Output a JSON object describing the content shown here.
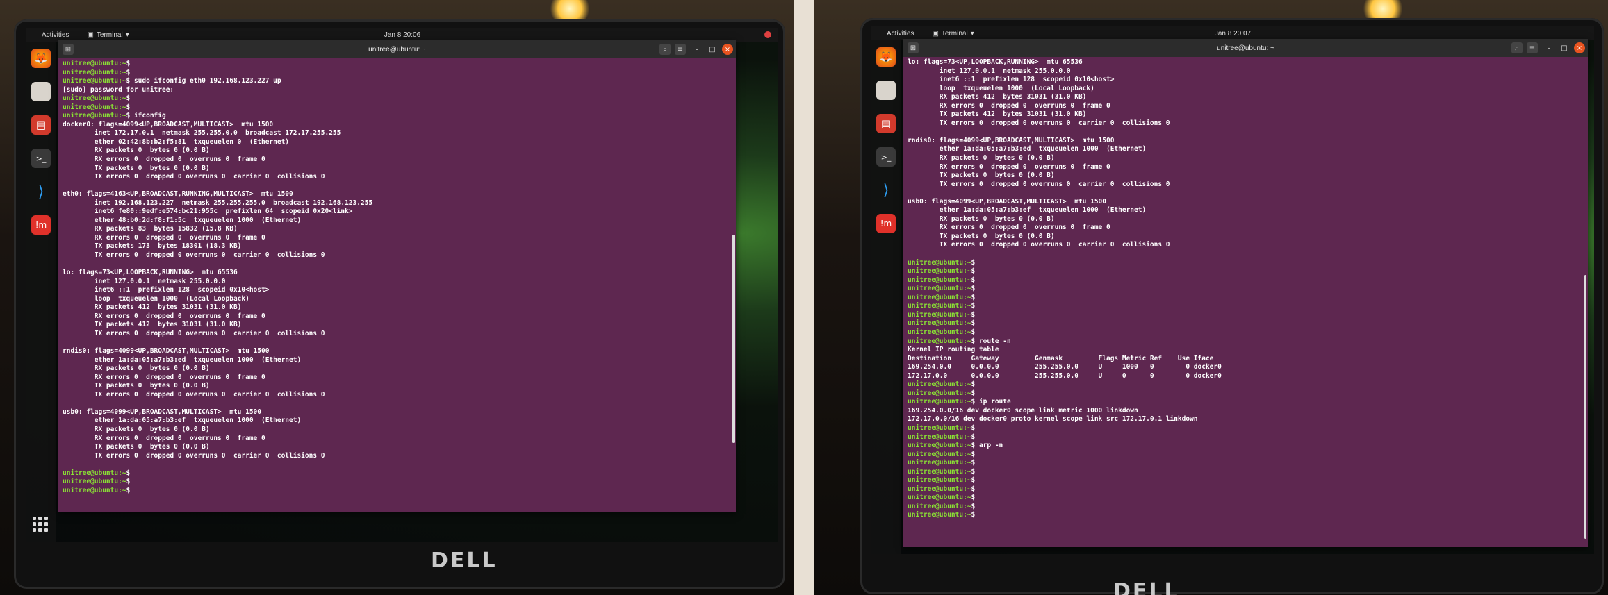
{
  "left": {
    "topbar": {
      "activities": "Activities",
      "app": "Terminal",
      "clock": "Jan 8  20:06"
    },
    "window_title": "unitree@ubuntu: ~",
    "lines": [
      {
        "p": "unitree@ubuntu:~",
        "t": "$"
      },
      {
        "p": "unitree@ubuntu:~",
        "t": "$"
      },
      {
        "p": "unitree@ubuntu:~",
        "t": "$ sudo ifconfig eth0 192.168.123.227 up"
      },
      {
        "p": "",
        "t": "[sudo] password for unitree:"
      },
      {
        "p": "unitree@ubuntu:~",
        "t": "$"
      },
      {
        "p": "unitree@ubuntu:~",
        "t": "$"
      },
      {
        "p": "unitree@ubuntu:~",
        "t": "$ ifconfig"
      },
      {
        "p": "",
        "t": "docker0: flags=4099<UP,BROADCAST,MULTICAST>  mtu 1500"
      },
      {
        "p": "",
        "t": "        inet 172.17.0.1  netmask 255.255.0.0  broadcast 172.17.255.255"
      },
      {
        "p": "",
        "t": "        ether 02:42:8b:b2:f5:81  txqueuelen 0  (Ethernet)"
      },
      {
        "p": "",
        "t": "        RX packets 0  bytes 0 (0.0 B)"
      },
      {
        "p": "",
        "t": "        RX errors 0  dropped 0  overruns 0  frame 0"
      },
      {
        "p": "",
        "t": "        TX packets 0  bytes 0 (0.0 B)"
      },
      {
        "p": "",
        "t": "        TX errors 0  dropped 0 overruns 0  carrier 0  collisions 0"
      },
      {
        "p": "",
        "t": ""
      },
      {
        "p": "",
        "t": "eth0: flags=4163<UP,BROADCAST,RUNNING,MULTICAST>  mtu 1500"
      },
      {
        "p": "",
        "t": "        inet 192.168.123.227  netmask 255.255.255.0  broadcast 192.168.123.255"
      },
      {
        "p": "",
        "t": "        inet6 fe80::9edf:e574:bc21:955c  prefixlen 64  scopeid 0x20<link>"
      },
      {
        "p": "",
        "t": "        ether 48:b0:2d:f8:f1:5c  txqueuelen 1000  (Ethernet)"
      },
      {
        "p": "",
        "t": "        RX packets 83  bytes 15832 (15.8 KB)"
      },
      {
        "p": "",
        "t": "        RX errors 0  dropped 0  overruns 0  frame 0"
      },
      {
        "p": "",
        "t": "        TX packets 173  bytes 18301 (18.3 KB)"
      },
      {
        "p": "",
        "t": "        TX errors 0  dropped 0 overruns 0  carrier 0  collisions 0"
      },
      {
        "p": "",
        "t": ""
      },
      {
        "p": "",
        "t": "lo: flags=73<UP,LOOPBACK,RUNNING>  mtu 65536"
      },
      {
        "p": "",
        "t": "        inet 127.0.0.1  netmask 255.0.0.0"
      },
      {
        "p": "",
        "t": "        inet6 ::1  prefixlen 128  scopeid 0x10<host>"
      },
      {
        "p": "",
        "t": "        loop  txqueuelen 1000  (Local Loopback)"
      },
      {
        "p": "",
        "t": "        RX packets 412  bytes 31031 (31.0 KB)"
      },
      {
        "p": "",
        "t": "        RX errors 0  dropped 0  overruns 0  frame 0"
      },
      {
        "p": "",
        "t": "        TX packets 412  bytes 31031 (31.0 KB)"
      },
      {
        "p": "",
        "t": "        TX errors 0  dropped 0 overruns 0  carrier 0  collisions 0"
      },
      {
        "p": "",
        "t": ""
      },
      {
        "p": "",
        "t": "rndis0: flags=4099<UP,BROADCAST,MULTICAST>  mtu 1500"
      },
      {
        "p": "",
        "t": "        ether 1a:da:05:a7:b3:ed  txqueuelen 1000  (Ethernet)"
      },
      {
        "p": "",
        "t": "        RX packets 0  bytes 0 (0.0 B)"
      },
      {
        "p": "",
        "t": "        RX errors 0  dropped 0  overruns 0  frame 0"
      },
      {
        "p": "",
        "t": "        TX packets 0  bytes 0 (0.0 B)"
      },
      {
        "p": "",
        "t": "        TX errors 0  dropped 0 overruns 0  carrier 0  collisions 0"
      },
      {
        "p": "",
        "t": ""
      },
      {
        "p": "",
        "t": "usb0: flags=4099<UP,BROADCAST,MULTICAST>  mtu 1500"
      },
      {
        "p": "",
        "t": "        ether 1a:da:05:a7:b3:ef  txqueuelen 1000  (Ethernet)"
      },
      {
        "p": "",
        "t": "        RX packets 0  bytes 0 (0.0 B)"
      },
      {
        "p": "",
        "t": "        RX errors 0  dropped 0  overruns 0  frame 0"
      },
      {
        "p": "",
        "t": "        TX packets 0  bytes 0 (0.0 B)"
      },
      {
        "p": "",
        "t": "        TX errors 0  dropped 0 overruns 0  carrier 0  collisions 0"
      },
      {
        "p": "",
        "t": ""
      },
      {
        "p": "unitree@ubuntu:~",
        "t": "$"
      },
      {
        "p": "unitree@ubuntu:~",
        "t": "$"
      },
      {
        "p": "unitree@ubuntu:~",
        "t": "$"
      }
    ]
  },
  "right": {
    "topbar": {
      "activities": "Activities",
      "app": "Terminal",
      "clock": "Jan 8  20:07"
    },
    "window_title": "unitree@ubuntu: ~",
    "lines": [
      {
        "p": "",
        "t": "lo: flags=73<UP,LOOPBACK,RUNNING>  mtu 65536"
      },
      {
        "p": "",
        "t": "        inet 127.0.0.1  netmask 255.0.0.0"
      },
      {
        "p": "",
        "t": "        inet6 ::1  prefixlen 128  scopeid 0x10<host>"
      },
      {
        "p": "",
        "t": "        loop  txqueuelen 1000  (Local Loopback)"
      },
      {
        "p": "",
        "t": "        RX packets 412  bytes 31031 (31.0 KB)"
      },
      {
        "p": "",
        "t": "        RX errors 0  dropped 0  overruns 0  frame 0"
      },
      {
        "p": "",
        "t": "        TX packets 412  bytes 31031 (31.0 KB)"
      },
      {
        "p": "",
        "t": "        TX errors 0  dropped 0 overruns 0  carrier 0  collisions 0"
      },
      {
        "p": "",
        "t": ""
      },
      {
        "p": "",
        "t": "rndis0: flags=4099<UP,BROADCAST,MULTICAST>  mtu 1500"
      },
      {
        "p": "",
        "t": "        ether 1a:da:05:a7:b3:ed  txqueuelen 1000  (Ethernet)"
      },
      {
        "p": "",
        "t": "        RX packets 0  bytes 0 (0.0 B)"
      },
      {
        "p": "",
        "t": "        RX errors 0  dropped 0  overruns 0  frame 0"
      },
      {
        "p": "",
        "t": "        TX packets 0  bytes 0 (0.0 B)"
      },
      {
        "p": "",
        "t": "        TX errors 0  dropped 0 overruns 0  carrier 0  collisions 0"
      },
      {
        "p": "",
        "t": ""
      },
      {
        "p": "",
        "t": "usb0: flags=4099<UP,BROADCAST,MULTICAST>  mtu 1500"
      },
      {
        "p": "",
        "t": "        ether 1a:da:05:a7:b3:ef  txqueuelen 1000  (Ethernet)"
      },
      {
        "p": "",
        "t": "        RX packets 0  bytes 0 (0.0 B)"
      },
      {
        "p": "",
        "t": "        RX errors 0  dropped 0  overruns 0  frame 0"
      },
      {
        "p": "",
        "t": "        TX packets 0  bytes 0 (0.0 B)"
      },
      {
        "p": "",
        "t": "        TX errors 0  dropped 0 overruns 0  carrier 0  collisions 0"
      },
      {
        "p": "",
        "t": ""
      },
      {
        "p": "unitree@ubuntu:~",
        "t": "$"
      },
      {
        "p": "unitree@ubuntu:~",
        "t": "$"
      },
      {
        "p": "unitree@ubuntu:~",
        "t": "$"
      },
      {
        "p": "unitree@ubuntu:~",
        "t": "$"
      },
      {
        "p": "unitree@ubuntu:~",
        "t": "$"
      },
      {
        "p": "unitree@ubuntu:~",
        "t": "$"
      },
      {
        "p": "unitree@ubuntu:~",
        "t": "$"
      },
      {
        "p": "unitree@ubuntu:~",
        "t": "$"
      },
      {
        "p": "unitree@ubuntu:~",
        "t": "$"
      },
      {
        "p": "unitree@ubuntu:~",
        "t": "$ route -n"
      },
      {
        "p": "",
        "t": "Kernel IP routing table"
      },
      {
        "p": "",
        "t": "Destination     Gateway         Genmask         Flags Metric Ref    Use Iface"
      },
      {
        "p": "",
        "t": "169.254.0.0     0.0.0.0         255.255.0.0     U     1000   0        0 docker0"
      },
      {
        "p": "",
        "t": "172.17.0.0      0.0.0.0         255.255.0.0     U     0      0        0 docker0"
      },
      {
        "p": "unitree@ubuntu:~",
        "t": "$"
      },
      {
        "p": "unitree@ubuntu:~",
        "t": "$"
      },
      {
        "p": "unitree@ubuntu:~",
        "t": "$ ip route"
      },
      {
        "p": "",
        "t": "169.254.0.0/16 dev docker0 scope link metric 1000 linkdown"
      },
      {
        "p": "",
        "t": "172.17.0.0/16 dev docker0 proto kernel scope link src 172.17.0.1 linkdown"
      },
      {
        "p": "unitree@ubuntu:~",
        "t": "$"
      },
      {
        "p": "unitree@ubuntu:~",
        "t": "$"
      },
      {
        "p": "unitree@ubuntu:~",
        "t": "$ arp -n"
      },
      {
        "p": "unitree@ubuntu:~",
        "t": "$"
      },
      {
        "p": "unitree@ubuntu:~",
        "t": "$"
      },
      {
        "p": "unitree@ubuntu:~",
        "t": "$"
      },
      {
        "p": "unitree@ubuntu:~",
        "t": "$"
      },
      {
        "p": "unitree@ubuntu:~",
        "t": "$"
      },
      {
        "p": "unitree@ubuntu:~",
        "t": "$"
      },
      {
        "p": "unitree@ubuntu:~",
        "t": "$"
      },
      {
        "p": "unitree@ubuntu:~",
        "t": "$"
      }
    ]
  },
  "dock_icons": [
    "firefox-icon",
    "files-icon",
    "software-icon",
    "terminal-icon",
    "vscode-icon",
    "app-red-icon"
  ],
  "brand": "DELL",
  "colors": {
    "terminal_bg": "#5e2750",
    "prompt": "#8ae234",
    "titlebar": "#2c2c2c",
    "close": "#e95420"
  }
}
